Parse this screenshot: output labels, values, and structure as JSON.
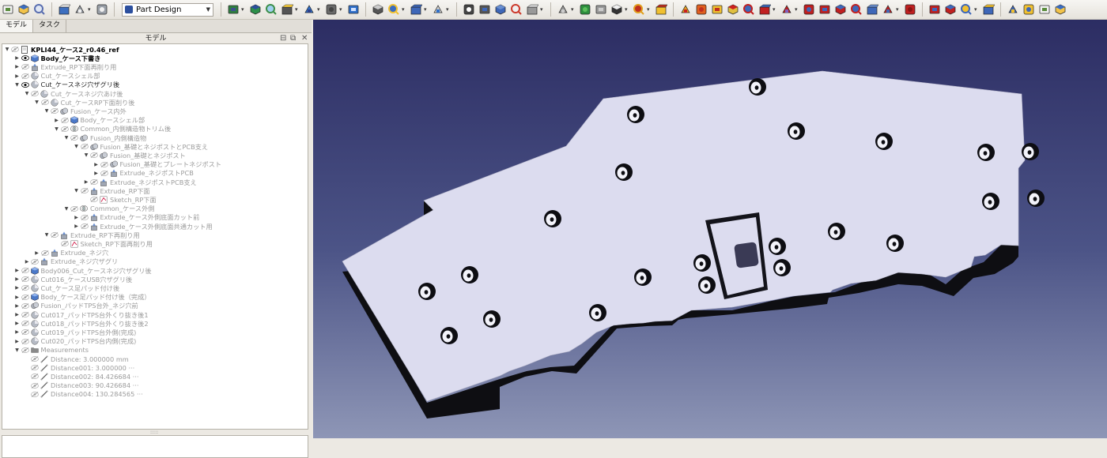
{
  "toolbar": {
    "workbench_label": "Part Design",
    "icons": [
      "new-file",
      "open-file",
      "save",
      "undo",
      "redo",
      "refresh",
      "workbench",
      "zoom-fit-all",
      "zoom-fit-selection",
      "view-axonometric",
      "fit-selection",
      "draw-style",
      "std-views",
      "measure",
      "macro",
      "part",
      "group",
      "link",
      "expression",
      "whats-this",
      "body",
      "sketch",
      "validate",
      "clone",
      "additive-primitive",
      "subtractive",
      "pad",
      "pocket"
    ]
  },
  "panel": {
    "tabs": [
      "モデル",
      "タスク"
    ],
    "title": "モデル",
    "tree": [
      {
        "depth": 0,
        "arrow": "down",
        "eye": false,
        "icon": "document",
        "label": "KPLI44_ケース2_r0.46_ref",
        "style": "bold"
      },
      {
        "depth": 1,
        "arrow": "right",
        "eye": true,
        "icon": "body",
        "label": "Body_ケース下書き",
        "style": "bold"
      },
      {
        "depth": 1,
        "arrow": "right",
        "eye": false,
        "icon": "extrude",
        "label": "Extrude_RP下面再削り用",
        "style": "gray"
      },
      {
        "depth": 1,
        "arrow": "right",
        "eye": false,
        "icon": "cut",
        "label": "Cut_ケースシェル部",
        "style": "gray"
      },
      {
        "depth": 1,
        "arrow": "down",
        "eye": true,
        "icon": "cut",
        "label": "Cut_ケースネジ穴ザグリ後",
        "style": "normal"
      },
      {
        "depth": 2,
        "arrow": "down",
        "eye": false,
        "icon": "cut",
        "label": "Cut_ケースネジ穴あけ後",
        "style": "gray"
      },
      {
        "depth": 3,
        "arrow": "down",
        "eye": false,
        "icon": "cut",
        "label": "Cut_ケースRP下面削り後",
        "style": "gray"
      },
      {
        "depth": 4,
        "arrow": "down",
        "eye": false,
        "icon": "fusion",
        "label": "Fusion_ケース内外",
        "style": "gray"
      },
      {
        "depth": 5,
        "arrow": "right",
        "eye": false,
        "icon": "body",
        "label": "Body_ケースシェル部",
        "style": "gray"
      },
      {
        "depth": 5,
        "arrow": "down",
        "eye": false,
        "icon": "common",
        "label": "Common_内側構造物トリム後",
        "style": "gray"
      },
      {
        "depth": 6,
        "arrow": "down",
        "eye": false,
        "icon": "fusion",
        "label": "Fusion_内側構造物",
        "style": "gray"
      },
      {
        "depth": 7,
        "arrow": "down",
        "eye": false,
        "icon": "fusion",
        "label": "Fusion_基礎とネジポストとPCB支え",
        "style": "gray"
      },
      {
        "depth": 8,
        "arrow": "down",
        "eye": false,
        "icon": "fusion",
        "label": "Fusion_基礎とネジポスト",
        "style": "gray"
      },
      {
        "depth": 9,
        "arrow": "right",
        "eye": false,
        "icon": "fusion",
        "label": "Fusion_基礎とプレートネジポスト",
        "style": "gray"
      },
      {
        "depth": 9,
        "arrow": "right",
        "eye": false,
        "icon": "extrude",
        "label": "Extrude_ネジポストPCB",
        "style": "gray"
      },
      {
        "depth": 8,
        "arrow": "right",
        "eye": false,
        "icon": "extrude",
        "label": "Extrude_ネジポストPCB支え",
        "style": "gray"
      },
      {
        "depth": 7,
        "arrow": "down",
        "eye": false,
        "icon": "extrude",
        "label": "Extrude_RP下面",
        "style": "gray"
      },
      {
        "depth": 8,
        "arrow": "none",
        "eye": false,
        "icon": "sketch",
        "label": "Sketch_RP下面",
        "style": "gray"
      },
      {
        "depth": 6,
        "arrow": "down",
        "eye": false,
        "icon": "common",
        "label": "Common_ケース外側",
        "style": "gray"
      },
      {
        "depth": 7,
        "arrow": "right",
        "eye": false,
        "icon": "extrude",
        "label": "Extrude_ケース外側底面カット前",
        "style": "gray"
      },
      {
        "depth": 7,
        "arrow": "right",
        "eye": false,
        "icon": "extrude",
        "label": "Extrude_ケース外側底面共通カット用",
        "style": "gray"
      },
      {
        "depth": 4,
        "arrow": "down",
        "eye": false,
        "icon": "extrude",
        "label": "Extrude_RP下再削り用",
        "style": "gray"
      },
      {
        "depth": 5,
        "arrow": "none",
        "eye": false,
        "icon": "sketch",
        "label": "Sketch_RP下面再削り用",
        "style": "gray"
      },
      {
        "depth": 3,
        "arrow": "right",
        "eye": false,
        "icon": "extrude",
        "label": "Extrude_ネジ穴",
        "style": "gray"
      },
      {
        "depth": 2,
        "arrow": "right",
        "eye": false,
        "icon": "extrude",
        "label": "Extrude_ネジ穴ザグリ",
        "style": "gray"
      },
      {
        "depth": 1,
        "arrow": "right",
        "eye": false,
        "icon": "body",
        "label": "Body006_Cut_ケースネジ穴ザグリ後",
        "style": "gray"
      },
      {
        "depth": 1,
        "arrow": "right",
        "eye": false,
        "icon": "cut",
        "label": "Cut016_ケースUSB穴ザグリ後",
        "style": "gray"
      },
      {
        "depth": 1,
        "arrow": "right",
        "eye": false,
        "icon": "cut",
        "label": "Cut_ケース足パッド付け後",
        "style": "gray"
      },
      {
        "depth": 1,
        "arrow": "right",
        "eye": false,
        "icon": "body",
        "label": "Body_ケース足パッド付け後（完成）",
        "style": "gray"
      },
      {
        "depth": 1,
        "arrow": "right",
        "eye": false,
        "icon": "fusion",
        "label": "Fusion_パッドTPS台外_ネジ穴前",
        "style": "gray"
      },
      {
        "depth": 1,
        "arrow": "right",
        "eye": false,
        "icon": "cut",
        "label": "Cut017_パッドTPS台外くり抜き後1",
        "style": "gray"
      },
      {
        "depth": 1,
        "arrow": "right",
        "eye": false,
        "icon": "cut",
        "label": "Cut018_パッドTPS台外くり抜き後2",
        "style": "gray"
      },
      {
        "depth": 1,
        "arrow": "right",
        "eye": false,
        "icon": "cut",
        "label": "Cut019_パッドTPS台外側(完成)",
        "style": "gray"
      },
      {
        "depth": 1,
        "arrow": "right",
        "eye": false,
        "icon": "cut",
        "label": "Cut020_パッドTPS台内側(完成)",
        "style": "gray"
      },
      {
        "depth": 1,
        "arrow": "down",
        "eye": false,
        "icon": "folder",
        "label": "Measurements",
        "style": "gray"
      },
      {
        "depth": 2,
        "arrow": "none",
        "eye": false,
        "icon": "measure",
        "label": "Distance: 3.000000 mm",
        "style": "gray"
      },
      {
        "depth": 2,
        "arrow": "none",
        "eye": false,
        "icon": "measure",
        "label": "Distance001: 3.000000 ···",
        "style": "gray"
      },
      {
        "depth": 2,
        "arrow": "none",
        "eye": false,
        "icon": "measure",
        "label": "Distance002: 84.426684 ···",
        "style": "gray"
      },
      {
        "depth": 2,
        "arrow": "none",
        "eye": false,
        "icon": "measure",
        "label": "Distance003: 90.426684 ···",
        "style": "gray"
      },
      {
        "depth": 2,
        "arrow": "none",
        "eye": false,
        "icon": "measure",
        "label": "Distance004: 130.284565 ···",
        "style": "gray"
      }
    ]
  },
  "viewport": {
    "background_top": "#2c2d63",
    "background_bottom": "#8e96b6",
    "part_top_color": "#dcdcef",
    "part_side_color": "#0e0e12"
  }
}
